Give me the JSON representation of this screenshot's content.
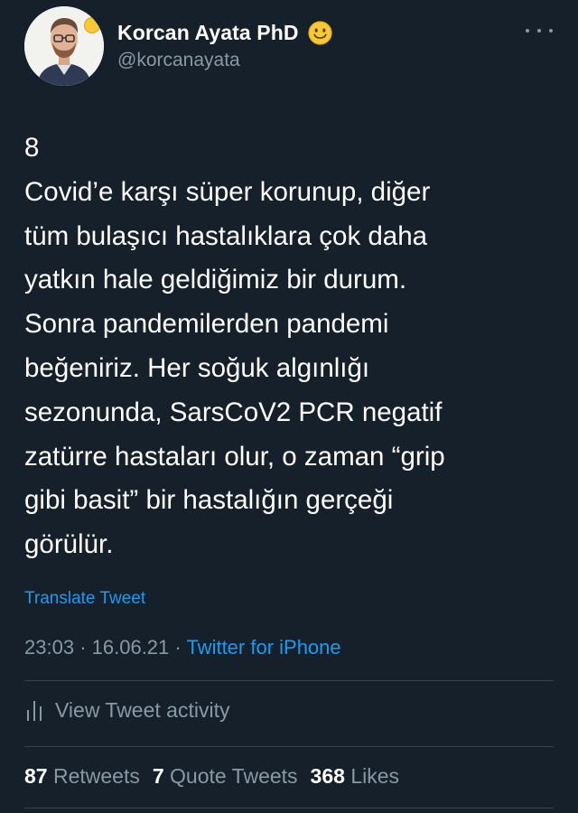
{
  "author": {
    "display_name": "Korcan Ayata PhD",
    "handle": "@korcanayata"
  },
  "tweet": {
    "lines": [
      "8",
      "Covid’e karşı süper korunup, diğer",
      "tüm bulaşıcı hastalıklara çok daha",
      "yatkın hale geldiğimiz bir durum.",
      "Sonra pandemilerden pandemi",
      "beğeniriz. Her soğuk algınlığı",
      "sezonunda, SarsCoV2 PCR negatif",
      "zatürre hastaları olur, o zaman “grip",
      "gibi basit” bir hastalığın gerçeği",
      "görülür."
    ],
    "translate_label": "Translate Tweet",
    "time": "23:03",
    "date": "16.06.21",
    "separator": "·",
    "source": "Twitter for iPhone"
  },
  "activity": {
    "label": "View Tweet activity"
  },
  "stats": {
    "retweets": {
      "count": "87",
      "label": "Retweets"
    },
    "quote_tweets": {
      "count": "7",
      "label": "Quote Tweets"
    },
    "likes": {
      "count": "368",
      "label": "Likes"
    }
  },
  "colors": {
    "background": "#15202b",
    "text": "#ffffff",
    "secondary": "#8899a6",
    "link": "#1d9bf0",
    "divider": "#38444d"
  },
  "icons": {
    "name_badge": "smiling-face-emoji",
    "more": "more-horizontal-icon",
    "activity": "bar-chart-icon"
  }
}
